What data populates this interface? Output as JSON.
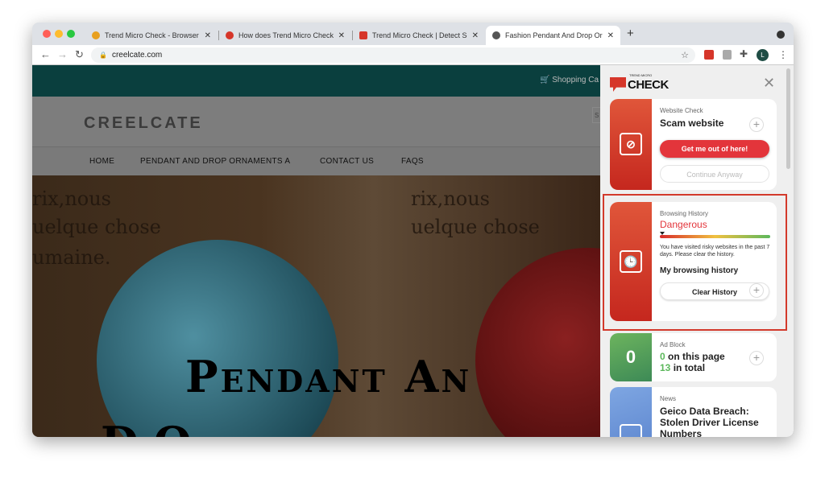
{
  "browser": {
    "tabs": [
      {
        "title": "Trend Micro Check - Browser S",
        "close": "✕",
        "favicon_color": "#e8a020"
      },
      {
        "title": "How does Trend Micro Check w",
        "close": "✕",
        "favicon_color": "#d6362a"
      },
      {
        "title": "Trend Micro Check | Detect Sc",
        "close": "✕",
        "favicon_color": "#d6362a"
      },
      {
        "title": "Fashion Pendant And Drop Orn",
        "close": "✕",
        "favicon_color": "#555555"
      }
    ],
    "new_tab": "+",
    "url": "creelcate.com",
    "profile_initial": "L"
  },
  "site": {
    "cart": "Shopping Ca",
    "logo": "CREELCATE",
    "search_placeholder": "S",
    "menu": [
      "HOME",
      "PENDANT AND DROP ORNAMENTS A",
      "CONTACT US",
      "FAQS"
    ],
    "hero_line1": "Pendant An",
    "hero_line2": "D     O",
    "hero_script": [
      "rix,nous",
      "uelque chose",
      "umaine."
    ]
  },
  "panel": {
    "brand_small": "TREND MICRO",
    "brand": "CHECK",
    "close": "✕",
    "website_check": {
      "label": "Website Check",
      "status": "Scam website",
      "primary": "Get me out of here!",
      "secondary": "Continue Anyway"
    },
    "browsing_history": {
      "label": "Browsing History",
      "status": "Dangerous",
      "risk_level": 0.0,
      "status_color": "#e3353b",
      "desc": "You have visited risky websites in the past 7 days. Please clear the history.",
      "link": "My browsing history",
      "button": "Clear History"
    },
    "ad_block": {
      "label": "Ad Block",
      "count": "0",
      "page_count": "0",
      "page_text": " on this page",
      "total_count": "13",
      "total_text": " in total",
      "accent": "#5cb85c"
    },
    "news": {
      "label": "News",
      "headline": "Geico Data Breach: Stolen Driver License Numbers"
    }
  }
}
